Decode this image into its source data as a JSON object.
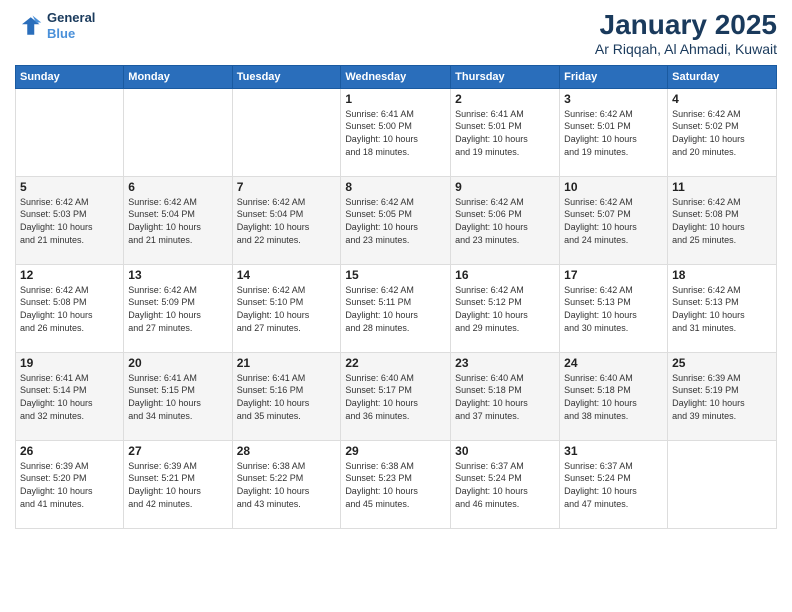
{
  "header": {
    "logo_line1": "General",
    "logo_line2": "Blue",
    "month": "January 2025",
    "location": "Ar Riqqah, Al Ahmadi, Kuwait"
  },
  "weekdays": [
    "Sunday",
    "Monday",
    "Tuesday",
    "Wednesday",
    "Thursday",
    "Friday",
    "Saturday"
  ],
  "weeks": [
    [
      {
        "day": "",
        "info": ""
      },
      {
        "day": "",
        "info": ""
      },
      {
        "day": "",
        "info": ""
      },
      {
        "day": "1",
        "info": "Sunrise: 6:41 AM\nSunset: 5:00 PM\nDaylight: 10 hours\nand 18 minutes."
      },
      {
        "day": "2",
        "info": "Sunrise: 6:41 AM\nSunset: 5:01 PM\nDaylight: 10 hours\nand 19 minutes."
      },
      {
        "day": "3",
        "info": "Sunrise: 6:42 AM\nSunset: 5:01 PM\nDaylight: 10 hours\nand 19 minutes."
      },
      {
        "day": "4",
        "info": "Sunrise: 6:42 AM\nSunset: 5:02 PM\nDaylight: 10 hours\nand 20 minutes."
      }
    ],
    [
      {
        "day": "5",
        "info": "Sunrise: 6:42 AM\nSunset: 5:03 PM\nDaylight: 10 hours\nand 21 minutes."
      },
      {
        "day": "6",
        "info": "Sunrise: 6:42 AM\nSunset: 5:04 PM\nDaylight: 10 hours\nand 21 minutes."
      },
      {
        "day": "7",
        "info": "Sunrise: 6:42 AM\nSunset: 5:04 PM\nDaylight: 10 hours\nand 22 minutes."
      },
      {
        "day": "8",
        "info": "Sunrise: 6:42 AM\nSunset: 5:05 PM\nDaylight: 10 hours\nand 23 minutes."
      },
      {
        "day": "9",
        "info": "Sunrise: 6:42 AM\nSunset: 5:06 PM\nDaylight: 10 hours\nand 23 minutes."
      },
      {
        "day": "10",
        "info": "Sunrise: 6:42 AM\nSunset: 5:07 PM\nDaylight: 10 hours\nand 24 minutes."
      },
      {
        "day": "11",
        "info": "Sunrise: 6:42 AM\nSunset: 5:08 PM\nDaylight: 10 hours\nand 25 minutes."
      }
    ],
    [
      {
        "day": "12",
        "info": "Sunrise: 6:42 AM\nSunset: 5:08 PM\nDaylight: 10 hours\nand 26 minutes."
      },
      {
        "day": "13",
        "info": "Sunrise: 6:42 AM\nSunset: 5:09 PM\nDaylight: 10 hours\nand 27 minutes."
      },
      {
        "day": "14",
        "info": "Sunrise: 6:42 AM\nSunset: 5:10 PM\nDaylight: 10 hours\nand 27 minutes."
      },
      {
        "day": "15",
        "info": "Sunrise: 6:42 AM\nSunset: 5:11 PM\nDaylight: 10 hours\nand 28 minutes."
      },
      {
        "day": "16",
        "info": "Sunrise: 6:42 AM\nSunset: 5:12 PM\nDaylight: 10 hours\nand 29 minutes."
      },
      {
        "day": "17",
        "info": "Sunrise: 6:42 AM\nSunset: 5:13 PM\nDaylight: 10 hours\nand 30 minutes."
      },
      {
        "day": "18",
        "info": "Sunrise: 6:42 AM\nSunset: 5:13 PM\nDaylight: 10 hours\nand 31 minutes."
      }
    ],
    [
      {
        "day": "19",
        "info": "Sunrise: 6:41 AM\nSunset: 5:14 PM\nDaylight: 10 hours\nand 32 minutes."
      },
      {
        "day": "20",
        "info": "Sunrise: 6:41 AM\nSunset: 5:15 PM\nDaylight: 10 hours\nand 34 minutes."
      },
      {
        "day": "21",
        "info": "Sunrise: 6:41 AM\nSunset: 5:16 PM\nDaylight: 10 hours\nand 35 minutes."
      },
      {
        "day": "22",
        "info": "Sunrise: 6:40 AM\nSunset: 5:17 PM\nDaylight: 10 hours\nand 36 minutes."
      },
      {
        "day": "23",
        "info": "Sunrise: 6:40 AM\nSunset: 5:18 PM\nDaylight: 10 hours\nand 37 minutes."
      },
      {
        "day": "24",
        "info": "Sunrise: 6:40 AM\nSunset: 5:18 PM\nDaylight: 10 hours\nand 38 minutes."
      },
      {
        "day": "25",
        "info": "Sunrise: 6:39 AM\nSunset: 5:19 PM\nDaylight: 10 hours\nand 39 minutes."
      }
    ],
    [
      {
        "day": "26",
        "info": "Sunrise: 6:39 AM\nSunset: 5:20 PM\nDaylight: 10 hours\nand 41 minutes."
      },
      {
        "day": "27",
        "info": "Sunrise: 6:39 AM\nSunset: 5:21 PM\nDaylight: 10 hours\nand 42 minutes."
      },
      {
        "day": "28",
        "info": "Sunrise: 6:38 AM\nSunset: 5:22 PM\nDaylight: 10 hours\nand 43 minutes."
      },
      {
        "day": "29",
        "info": "Sunrise: 6:38 AM\nSunset: 5:23 PM\nDaylight: 10 hours\nand 45 minutes."
      },
      {
        "day": "30",
        "info": "Sunrise: 6:37 AM\nSunset: 5:24 PM\nDaylight: 10 hours\nand 46 minutes."
      },
      {
        "day": "31",
        "info": "Sunrise: 6:37 AM\nSunset: 5:24 PM\nDaylight: 10 hours\nand 47 minutes."
      },
      {
        "day": "",
        "info": ""
      }
    ]
  ]
}
